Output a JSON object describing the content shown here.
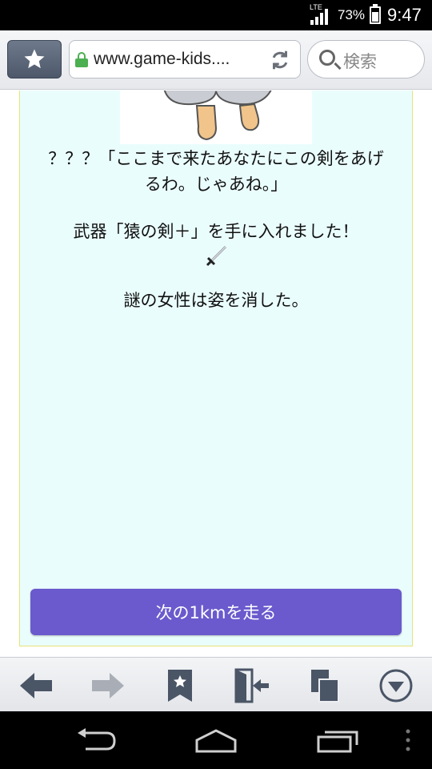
{
  "status_bar": {
    "network": "LTE",
    "battery": "73%",
    "battery_level": 0.73,
    "time": "9:47"
  },
  "browser": {
    "url": "www.game-kids....",
    "search_placeholder": "検索"
  },
  "story": {
    "line1": "？？？「ここまで来たあなたにこの剣をあげ",
    "line2": "るわ。じゃあね。」",
    "line3": "武器「猿の剣＋」を手に入れました！",
    "line4": "謎の女性は姿を消した。"
  },
  "action_button": {
    "label": "次の1kmを走る"
  },
  "colors": {
    "panel_bg": "#eafdfd",
    "panel_border": "#e7e37a",
    "button": "#6a5acd"
  },
  "icons": {
    "bookmark_star": "star-icon",
    "lock": "lock-icon",
    "reload": "reload-icon",
    "search": "search-icon",
    "back": "back-arrow-icon",
    "forward": "forward-arrow-icon",
    "bookmark": "bookmark-icon",
    "exit": "exit-door-icon",
    "tabs": "tabs-icon",
    "menu": "menu-down-icon",
    "sword": "sword-icon"
  }
}
